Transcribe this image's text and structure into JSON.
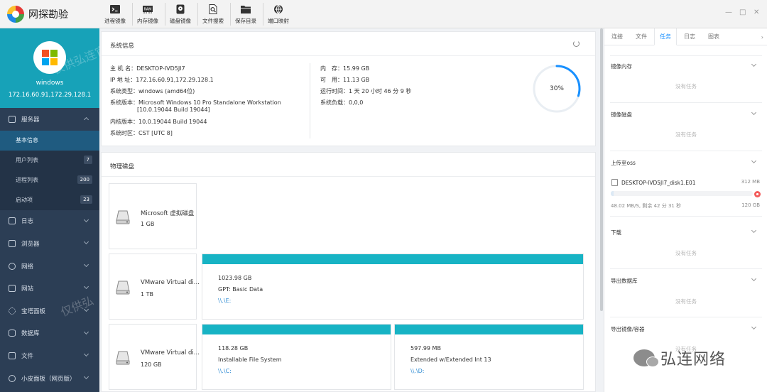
{
  "app": {
    "title": "网探勘验"
  },
  "toolbar": [
    {
      "label": "进程镜像",
      "icon": "terminal-icon"
    },
    {
      "label": "内存镜像",
      "icon": "ram-icon"
    },
    {
      "label": "磁盘镜像",
      "icon": "disk-image-icon"
    },
    {
      "label": "文件搜索",
      "icon": "file-search-icon"
    },
    {
      "label": "保存目录",
      "icon": "folder-icon"
    },
    {
      "label": "端口映射",
      "icon": "port-map-icon"
    }
  ],
  "window_controls": {
    "minimize": "—",
    "maximize": "□",
    "close": "✕"
  },
  "sidebar": {
    "profile": {
      "name": "windows",
      "ip": "172.16.60.91,172.29.128.1",
      "watermark_a": "仅供弘连官方使用",
      "watermark_b": "仅供弘"
    },
    "items": [
      {
        "label": "服务器",
        "open": true
      },
      {
        "label": "日志"
      },
      {
        "label": "浏览器"
      },
      {
        "label": "网络"
      },
      {
        "label": "网站"
      },
      {
        "label": "宝塔面板"
      },
      {
        "label": "数据库"
      },
      {
        "label": "文件"
      },
      {
        "label": "小皮面板（网页版）"
      }
    ],
    "subitems": [
      {
        "label": "基本信息",
        "active": true,
        "badge": ""
      },
      {
        "label": "用户列表",
        "badge": "7"
      },
      {
        "label": "进程列表",
        "badge": "200"
      },
      {
        "label": "启动项",
        "badge": "23"
      }
    ]
  },
  "system_info": {
    "title": "系统信息",
    "left": [
      {
        "label": "主 机 名：",
        "value": "DESKTOP-IVD5JI7"
      },
      {
        "label": "IP 地 址：",
        "value": "172.16.60.91,172.29.128.1"
      },
      {
        "label": "系统类型：",
        "value": "windows (amd64位)"
      },
      {
        "label": "系统版本：",
        "value": "Microsoft Windows 10 Pro Standalone Workstation"
      },
      {
        "label": "",
        "value": "[10.0.19044 Build 19044]"
      },
      {
        "label": "内核版本：",
        "value": "10.0.19044 Build 19044"
      },
      {
        "label": "系统时区：",
        "value": "CST [UTC 8]"
      }
    ],
    "right": [
      {
        "label": "内　存：",
        "value": "15.99 GB"
      },
      {
        "label": "可　用：",
        "value": "11.13 GB"
      },
      {
        "label": "运行时间：",
        "value": "1 天 20 小时 46 分 9 秒"
      },
      {
        "label": "系统负载：",
        "value": "0,0,0"
      }
    ],
    "gauge": {
      "percent": 30,
      "label": "30%",
      "color": "#1890ff",
      "track": "#e9eef3"
    }
  },
  "physical_disks": {
    "title": "物理磁盘",
    "disks": [
      {
        "name": "Microsoft 虚拟磁盘",
        "size": "1 GB",
        "partitions": []
      },
      {
        "name": "VMware Virtual di...",
        "size": "1 TB",
        "partitions": [
          {
            "size": "1023.98 GB",
            "fs": "GPT: Basic Data",
            "path": "\\\\.\\E:"
          }
        ]
      },
      {
        "name": "VMware Virtual di...",
        "size": "120 GB",
        "partitions": [
          {
            "size": "118.28 GB",
            "fs": "Installable File System",
            "path": "\\\\.\\C:"
          },
          {
            "size": "597.99 MB",
            "fs": "Extended w/Extended Int 13",
            "path": "\\\\.\\D:"
          }
        ]
      }
    ]
  },
  "right_panel": {
    "tabs": [
      {
        "label": "连接"
      },
      {
        "label": "文件"
      },
      {
        "label": "任务",
        "active": true
      },
      {
        "label": "日志"
      },
      {
        "label": "图表"
      }
    ],
    "tab_more": "›",
    "sections": [
      {
        "title": "镜像内存",
        "empty": "没有任务"
      },
      {
        "title": "镜像磁盘",
        "empty": "没有任务"
      },
      {
        "title": "上传至oss"
      },
      {
        "title": "下载",
        "empty": "没有任务"
      },
      {
        "title": "导出数据库",
        "empty": "没有任务"
      },
      {
        "title": "导出镜像/容器",
        "empty": "没有任务"
      }
    ],
    "upload_task": {
      "name": "DESKTOP-IVD5JI7_disk1.E01",
      "size": "312 MB",
      "progress": 0.02,
      "speed": "48.02 MB/S, 剩余 42 分 31 秒",
      "total": "120 GB"
    }
  },
  "footer_watermark": {
    "text": "弘连网络"
  },
  "colors": {
    "sidebar": "#2c3e55",
    "profile": "#17a2b8",
    "accent": "#1890ff",
    "partition_bar": "#17b3c4",
    "cancel": "#f35b5b"
  }
}
